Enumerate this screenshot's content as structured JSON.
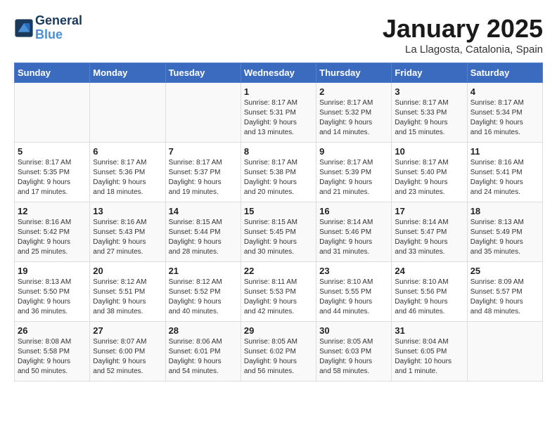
{
  "logo": {
    "line1": "General",
    "line2": "Blue"
  },
  "title": "January 2025",
  "subtitle": "La Llagosta, Catalonia, Spain",
  "weekdays": [
    "Sunday",
    "Monday",
    "Tuesday",
    "Wednesday",
    "Thursday",
    "Friday",
    "Saturday"
  ],
  "weeks": [
    [
      {
        "day": "",
        "info": ""
      },
      {
        "day": "",
        "info": ""
      },
      {
        "day": "",
        "info": ""
      },
      {
        "day": "1",
        "info": "Sunrise: 8:17 AM\nSunset: 5:31 PM\nDaylight: 9 hours\nand 13 minutes."
      },
      {
        "day": "2",
        "info": "Sunrise: 8:17 AM\nSunset: 5:32 PM\nDaylight: 9 hours\nand 14 minutes."
      },
      {
        "day": "3",
        "info": "Sunrise: 8:17 AM\nSunset: 5:33 PM\nDaylight: 9 hours\nand 15 minutes."
      },
      {
        "day": "4",
        "info": "Sunrise: 8:17 AM\nSunset: 5:34 PM\nDaylight: 9 hours\nand 16 minutes."
      }
    ],
    [
      {
        "day": "5",
        "info": "Sunrise: 8:17 AM\nSunset: 5:35 PM\nDaylight: 9 hours\nand 17 minutes."
      },
      {
        "day": "6",
        "info": "Sunrise: 8:17 AM\nSunset: 5:36 PM\nDaylight: 9 hours\nand 18 minutes."
      },
      {
        "day": "7",
        "info": "Sunrise: 8:17 AM\nSunset: 5:37 PM\nDaylight: 9 hours\nand 19 minutes."
      },
      {
        "day": "8",
        "info": "Sunrise: 8:17 AM\nSunset: 5:38 PM\nDaylight: 9 hours\nand 20 minutes."
      },
      {
        "day": "9",
        "info": "Sunrise: 8:17 AM\nSunset: 5:39 PM\nDaylight: 9 hours\nand 21 minutes."
      },
      {
        "day": "10",
        "info": "Sunrise: 8:17 AM\nSunset: 5:40 PM\nDaylight: 9 hours\nand 23 minutes."
      },
      {
        "day": "11",
        "info": "Sunrise: 8:16 AM\nSunset: 5:41 PM\nDaylight: 9 hours\nand 24 minutes."
      }
    ],
    [
      {
        "day": "12",
        "info": "Sunrise: 8:16 AM\nSunset: 5:42 PM\nDaylight: 9 hours\nand 25 minutes."
      },
      {
        "day": "13",
        "info": "Sunrise: 8:16 AM\nSunset: 5:43 PM\nDaylight: 9 hours\nand 27 minutes."
      },
      {
        "day": "14",
        "info": "Sunrise: 8:15 AM\nSunset: 5:44 PM\nDaylight: 9 hours\nand 28 minutes."
      },
      {
        "day": "15",
        "info": "Sunrise: 8:15 AM\nSunset: 5:45 PM\nDaylight: 9 hours\nand 30 minutes."
      },
      {
        "day": "16",
        "info": "Sunrise: 8:14 AM\nSunset: 5:46 PM\nDaylight: 9 hours\nand 31 minutes."
      },
      {
        "day": "17",
        "info": "Sunrise: 8:14 AM\nSunset: 5:47 PM\nDaylight: 9 hours\nand 33 minutes."
      },
      {
        "day": "18",
        "info": "Sunrise: 8:13 AM\nSunset: 5:49 PM\nDaylight: 9 hours\nand 35 minutes."
      }
    ],
    [
      {
        "day": "19",
        "info": "Sunrise: 8:13 AM\nSunset: 5:50 PM\nDaylight: 9 hours\nand 36 minutes."
      },
      {
        "day": "20",
        "info": "Sunrise: 8:12 AM\nSunset: 5:51 PM\nDaylight: 9 hours\nand 38 minutes."
      },
      {
        "day": "21",
        "info": "Sunrise: 8:12 AM\nSunset: 5:52 PM\nDaylight: 9 hours\nand 40 minutes."
      },
      {
        "day": "22",
        "info": "Sunrise: 8:11 AM\nSunset: 5:53 PM\nDaylight: 9 hours\nand 42 minutes."
      },
      {
        "day": "23",
        "info": "Sunrise: 8:10 AM\nSunset: 5:55 PM\nDaylight: 9 hours\nand 44 minutes."
      },
      {
        "day": "24",
        "info": "Sunrise: 8:10 AM\nSunset: 5:56 PM\nDaylight: 9 hours\nand 46 minutes."
      },
      {
        "day": "25",
        "info": "Sunrise: 8:09 AM\nSunset: 5:57 PM\nDaylight: 9 hours\nand 48 minutes."
      }
    ],
    [
      {
        "day": "26",
        "info": "Sunrise: 8:08 AM\nSunset: 5:58 PM\nDaylight: 9 hours\nand 50 minutes."
      },
      {
        "day": "27",
        "info": "Sunrise: 8:07 AM\nSunset: 6:00 PM\nDaylight: 9 hours\nand 52 minutes."
      },
      {
        "day": "28",
        "info": "Sunrise: 8:06 AM\nSunset: 6:01 PM\nDaylight: 9 hours\nand 54 minutes."
      },
      {
        "day": "29",
        "info": "Sunrise: 8:05 AM\nSunset: 6:02 PM\nDaylight: 9 hours\nand 56 minutes."
      },
      {
        "day": "30",
        "info": "Sunrise: 8:05 AM\nSunset: 6:03 PM\nDaylight: 9 hours\nand 58 minutes."
      },
      {
        "day": "31",
        "info": "Sunrise: 8:04 AM\nSunset: 6:05 PM\nDaylight: 10 hours\nand 1 minute."
      },
      {
        "day": "",
        "info": ""
      }
    ]
  ]
}
